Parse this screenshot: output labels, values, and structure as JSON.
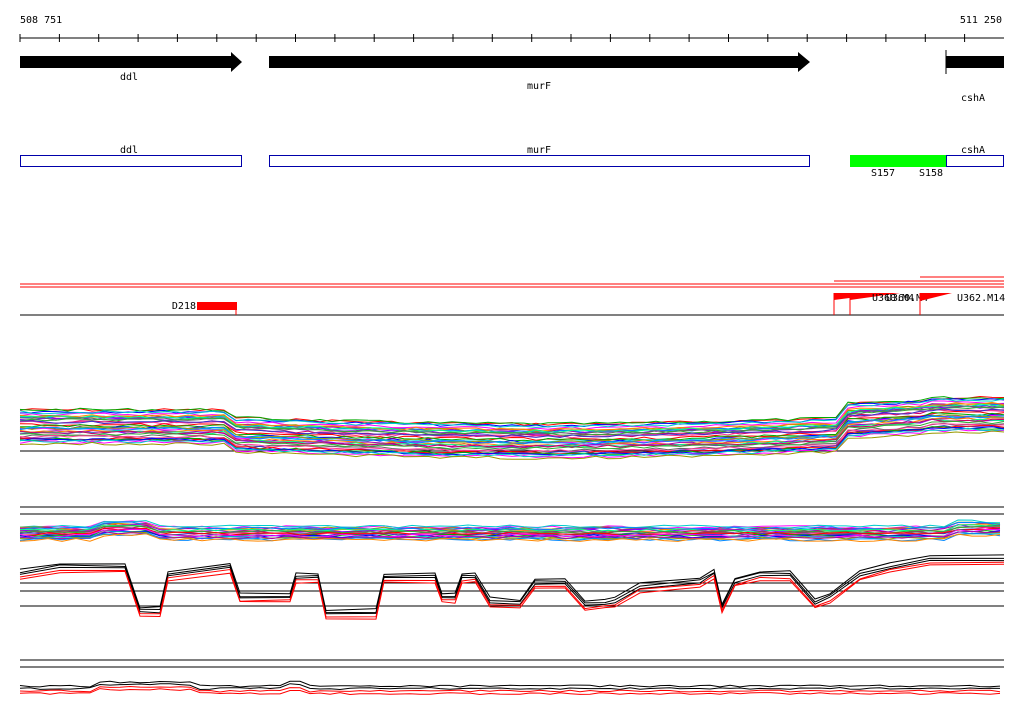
{
  "coordinates": {
    "start": "508 751",
    "end": "511 250"
  },
  "genes": [
    {
      "label": "ddl"
    },
    {
      "label": "murF"
    },
    {
      "label": "cshA"
    }
  ],
  "gene_boxes": [
    {
      "label": "ddl"
    },
    {
      "label": "murF"
    },
    {
      "label": "cshA"
    }
  ],
  "features": [
    {
      "label": "S157",
      "color": "#00ff00"
    },
    {
      "label": "S158",
      "color": "#00ff00"
    }
  ],
  "markers": [
    {
      "label": "D218",
      "color": "#ff0000"
    },
    {
      "label": "U360.M4",
      "color": "#ff0000"
    },
    {
      "label": "U360.M4",
      "color": "#ff0000"
    },
    {
      "label": "U362.M14",
      "color": "#ff0000"
    }
  ],
  "colors": {
    "arrow": "#000000",
    "box_outline": "#0000aa",
    "marker": "#ff0000",
    "feature": "#00ff00"
  }
}
